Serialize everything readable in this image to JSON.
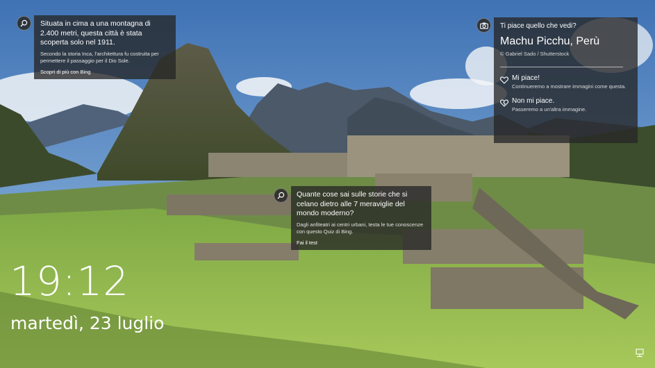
{
  "lockscreen": {
    "time": "19:12",
    "date": "martedì, 23 luglio"
  },
  "card_top_left": {
    "title": "Situata in cima a una montagna di 2.400 metri, questa città è stata scoperta solo nel 1911.",
    "subtitle": "Secondo la storia Inca, l'architettura fu costruita per permettere il passaggio per il Dio Sole.",
    "link": "Scopri di più con Bing",
    "icon": "search-icon"
  },
  "card_middle": {
    "title": "Quante cose sai sulle storie che si celano dietro alle 7 meraviglie del mondo moderno?",
    "subtitle": "Dagli anfiteatri ai centri urbani, testa le tue conoscenze con questo Quiz di Bing.",
    "link": "Fai il test",
    "icon": "search-icon"
  },
  "card_right": {
    "question": "Ti piace quello che vedi?",
    "place": "Machu Picchu, Perù",
    "credit": "© Gabriel Sado / Shutterstock",
    "like_title": "Mi piace!",
    "like_desc": "Continueremo a mostrare immagini come questa.",
    "dislike_title": "Non mi piace.",
    "dislike_desc": "Passeremo a un'altra immagine.",
    "icon": "camera-icon"
  },
  "tray": {
    "icon": "network-icon"
  }
}
